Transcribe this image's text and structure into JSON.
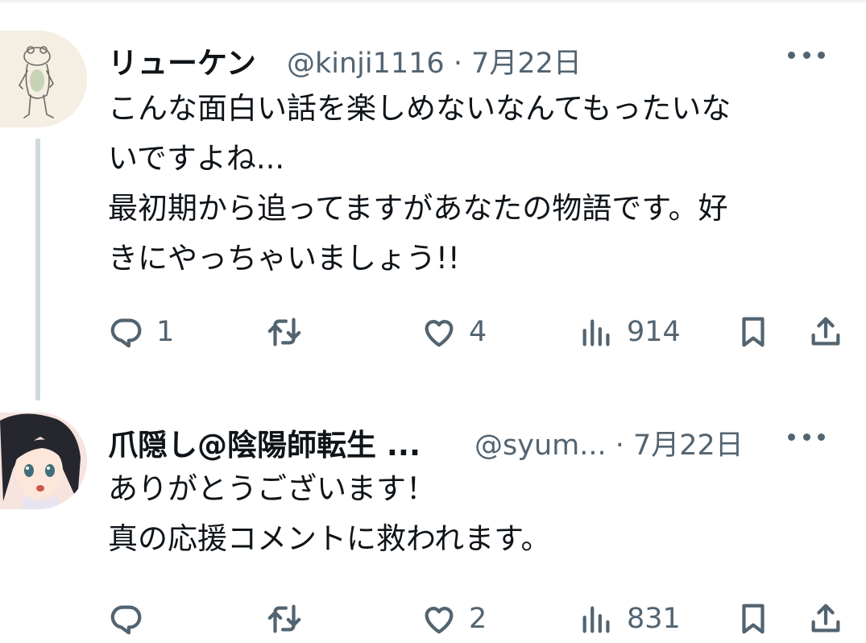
{
  "tweets": [
    {
      "name": "リューケン",
      "handle": "@kinji1116 · 7月22日",
      "lines": [
        "こんな面白い話を楽しめないなんてもったいな",
        "いですよね...",
        "最初期から追ってますがあなたの物語です。好",
        "きにやっちゃいましょう!!"
      ],
      "replies": "1",
      "retweets": "",
      "likes": "4",
      "views": "914"
    },
    {
      "name": "爪隠し@陰陽師転生 ...",
      "handle": "@syum... · 7月22日",
      "lines": [
        "ありがとうございます！",
        "真の応援コメントに救われます。"
      ],
      "replies": "",
      "retweets": "",
      "likes": "2",
      "views": "831"
    }
  ],
  "icons": {
    "reply": "speech-bubble-icon",
    "retweet": "retweet-arrows-icon",
    "like": "heart-icon",
    "views": "bar-chart-icon",
    "bookmark": "bookmark-icon",
    "share": "share-upload-icon",
    "more": "three-dots-icon"
  },
  "colors": {
    "text_primary": "#0f1419",
    "text_secondary": "#536471",
    "thread_line": "#cfd9de"
  }
}
